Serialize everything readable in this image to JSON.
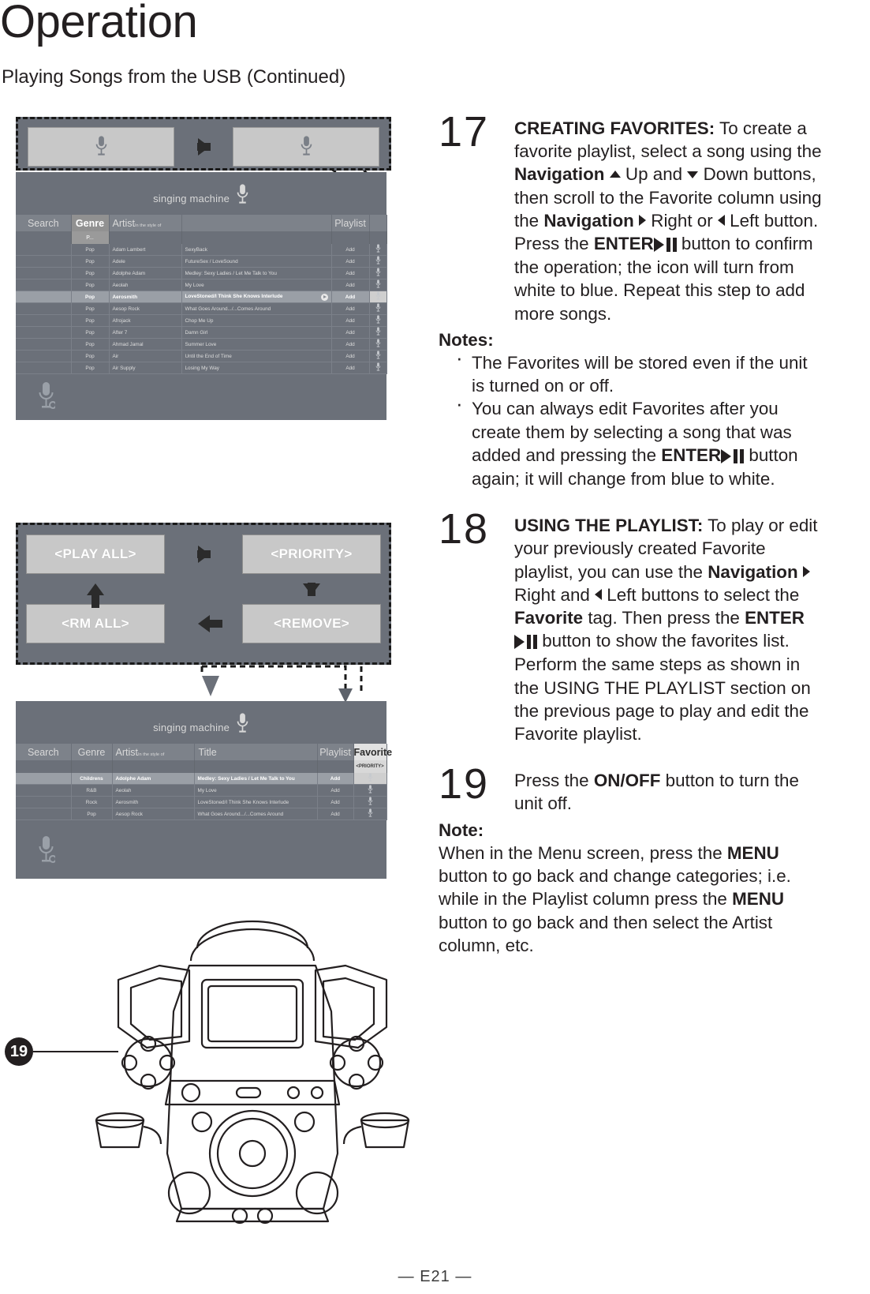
{
  "header": {
    "title": "Operation",
    "subtitle": "Playing Songs from the USB (Continued)"
  },
  "figures": {
    "screen_brand": "singing machine",
    "table1": {
      "columns": [
        "Search",
        "Genre",
        "Artist",
        "",
        "Playlist",
        ""
      ],
      "artist_sub": "In the style of",
      "selected_column": "Genre",
      "genre_filter": "P...",
      "rows": [
        {
          "genre": "Pop",
          "artist": "Adam Lambert",
          "title": "SexyBack",
          "playlist": "Add"
        },
        {
          "genre": "Pop",
          "artist": "Adele",
          "title": "FutureSex / LoveSound",
          "playlist": "Add"
        },
        {
          "genre": "Pop",
          "artist": "Adolphe Adam",
          "title": "Medley: Sexy Ladies / Let Me Talk to You",
          "playlist": "Add"
        },
        {
          "genre": "Pop",
          "artist": "Aeolah",
          "title": "My Love",
          "playlist": "Add"
        },
        {
          "genre": "Pop",
          "artist": "Aerosmith",
          "title": "LoveStoned/I Think She Knows Interlude",
          "playlist": "Add"
        },
        {
          "genre": "Pop",
          "artist": "Aesop Rock",
          "title": "What Goes Around.../...Comes Around",
          "playlist": "Add"
        },
        {
          "genre": "Pop",
          "artist": "Afrojack",
          "title": "Chop Me Up",
          "playlist": "Add"
        },
        {
          "genre": "Pop",
          "artist": "After 7",
          "title": "Damn Girl",
          "playlist": "Add"
        },
        {
          "genre": "Pop",
          "artist": "Ahmad Jamal",
          "title": "Summer Love",
          "playlist": "Add"
        },
        {
          "genre": "Pop",
          "artist": "Air",
          "title": "Until the End of Time",
          "playlist": "Add"
        },
        {
          "genre": "Pop",
          "artist": "Air Supply",
          "title": "Losing My Way",
          "playlist": "Add"
        }
      ],
      "highlighted_row_index": 4
    },
    "table2": {
      "columns": [
        "Search",
        "Genre",
        "Artist",
        "Title",
        "Playlist",
        "Favorite"
      ],
      "artist_sub": "In the style of",
      "selected_column": "Favorite",
      "favorite_tag": "<PRIORITY>",
      "rows": [
        {
          "genre": "Childrens",
          "artist": "Adolphe Adam",
          "title": "Medley: Sexy Ladies / Let Me Talk to You",
          "playlist": "Add"
        },
        {
          "genre": "R&B",
          "artist": "Aeolah",
          "title": "My Love",
          "playlist": "Add"
        },
        {
          "genre": "Rock",
          "artist": "Aerosmith",
          "title": "LoveStoned/I Think She Knows Interlude",
          "playlist": "Add"
        },
        {
          "genre": "Pop",
          "artist": "Aesop Rock",
          "title": "What Goes Around.../...Comes Around",
          "playlist": "Add"
        }
      ],
      "highlighted_row_index": 0
    },
    "flow": {
      "play_all": "<PLAY ALL>",
      "priority": "<PRIORITY>",
      "rm_all": "<RM ALL>",
      "remove": "<REMOVE>"
    },
    "callout_number": "19"
  },
  "steps": {
    "step17": {
      "number": "17",
      "heading": "CREATING FAVORITES:",
      "text_a": " To create a favorite playlist, select a song using the ",
      "bold_nav1": "Navigation",
      "text_b": " Up and ",
      "text_c": " Down buttons, then scroll to the Favorite column using the ",
      "bold_nav2": "Navigation",
      "text_d": " Right or ",
      "text_e": " Left button. Press the ",
      "bold_enter": "ENTER",
      "text_f": " button to confirm the operation; the icon will turn from white to blue. Repeat this step to add more songs."
    },
    "notes_label": "Notes:",
    "note1": "The Favorites will be stored even if the unit is turned on or off.",
    "note2_a": "You can always edit Favorites after you create them by selecting a song that was added and pressing the ",
    "note2_bold": "ENTER",
    "note2_b": " button again; it will change from blue to white.",
    "step18": {
      "number": "18",
      "heading": "USING THE PLAYLIST:",
      "text_a": " To play or edit your previously created Favorite playlist, you can use the ",
      "bold_nav": "Navigation",
      "text_b": " Right and ",
      "text_c": " Left buttons to select the ",
      "bold_fav": "Favorite",
      "text_d": " tag. Then press the ",
      "bold_enter": "ENTER",
      "text_e": " button to show the favorites list. Perform the same steps as shown in the USING THE PLAYLIST section on the previous page to play and edit the Favorite playlist."
    },
    "step19": {
      "number": "19",
      "text_a": "Press the ",
      "bold_onoff": "ON/OFF",
      "text_b": " button to turn the unit off."
    },
    "note_label": "Note:",
    "note3_a": "When in the Menu screen, press the ",
    "note3_bold1": "MENU",
    "note3_b": " button to go back and change categories; i.e. while in the Playlist column press the ",
    "note3_bold2": "MENU",
    "note3_c": " button to go back and then select the Artist column, etc."
  },
  "footer": {
    "page_number": "— E21 —"
  },
  "colors": {
    "screen_bg": "#6b7079",
    "header_bg": "#7d828a",
    "tile": "#c8c8c8",
    "text": "#231f20"
  }
}
